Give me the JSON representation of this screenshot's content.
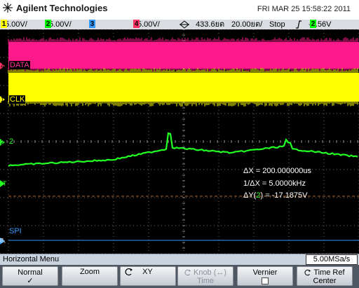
{
  "header": {
    "brand": "Agilent Technologies",
    "datetime": "FRI MAR 25 15:58:22 2011"
  },
  "status": {
    "ch1": {
      "num": "1",
      "scale": "5.00V/",
      "color": "#ffff00"
    },
    "ch2": {
      "num": "2",
      "scale": "5.00V/",
      "color": "#00ff00"
    },
    "ch3": {
      "num": "3",
      "color": "#3399ff"
    },
    "ch4": {
      "num": "4",
      "scale": "5.00V/",
      "color": "#ff3366"
    },
    "delay": "433.6ยต",
    "timebase": "20.00ยต/",
    "run_state": "Stop",
    "trigger_slope_icon": "rising-edge-icon",
    "trigger_channel": "2",
    "trigger_level": "-7.56V"
  },
  "screen": {
    "labels": {
      "data": "DATA",
      "clk": "CLK",
      "ch2": "2",
      "spi": "SPI"
    },
    "markers": {
      "ch4": "4",
      "ch1": "1",
      "ch2": "2",
      "trigger": "T",
      "bus": "B₁"
    },
    "measurements": {
      "dx": "ΔX = 200.000000us",
      "inv_dx": "1/ΔX = 5.0000kHz",
      "dy_prefix": "ΔY(",
      "dy_ch": "2",
      "dy_suffix": ") = -17.1875V"
    },
    "colors": {
      "data": "#ff1a8c",
      "clk": "#ffff00",
      "ch2": "#22ff22",
      "spi": "#3399ff",
      "cursor": "#b36a2a",
      "grid": "#6a6a6a"
    }
  },
  "menu": {
    "title": "Horizontal Menu",
    "sample_rate": "5.00MSa/s"
  },
  "softkeys": [
    {
      "line1": "Normal",
      "line2": "✓"
    },
    {
      "line1": "Zoom",
      "line2": ""
    },
    {
      "line1": "XY",
      "line2": ""
    },
    {
      "line1": "Knob (↔)",
      "line2": "Time"
    },
    {
      "line1": "Vernier",
      "line2": ""
    },
    {
      "line1": "Time Ref",
      "line2": "Center"
    }
  ]
}
